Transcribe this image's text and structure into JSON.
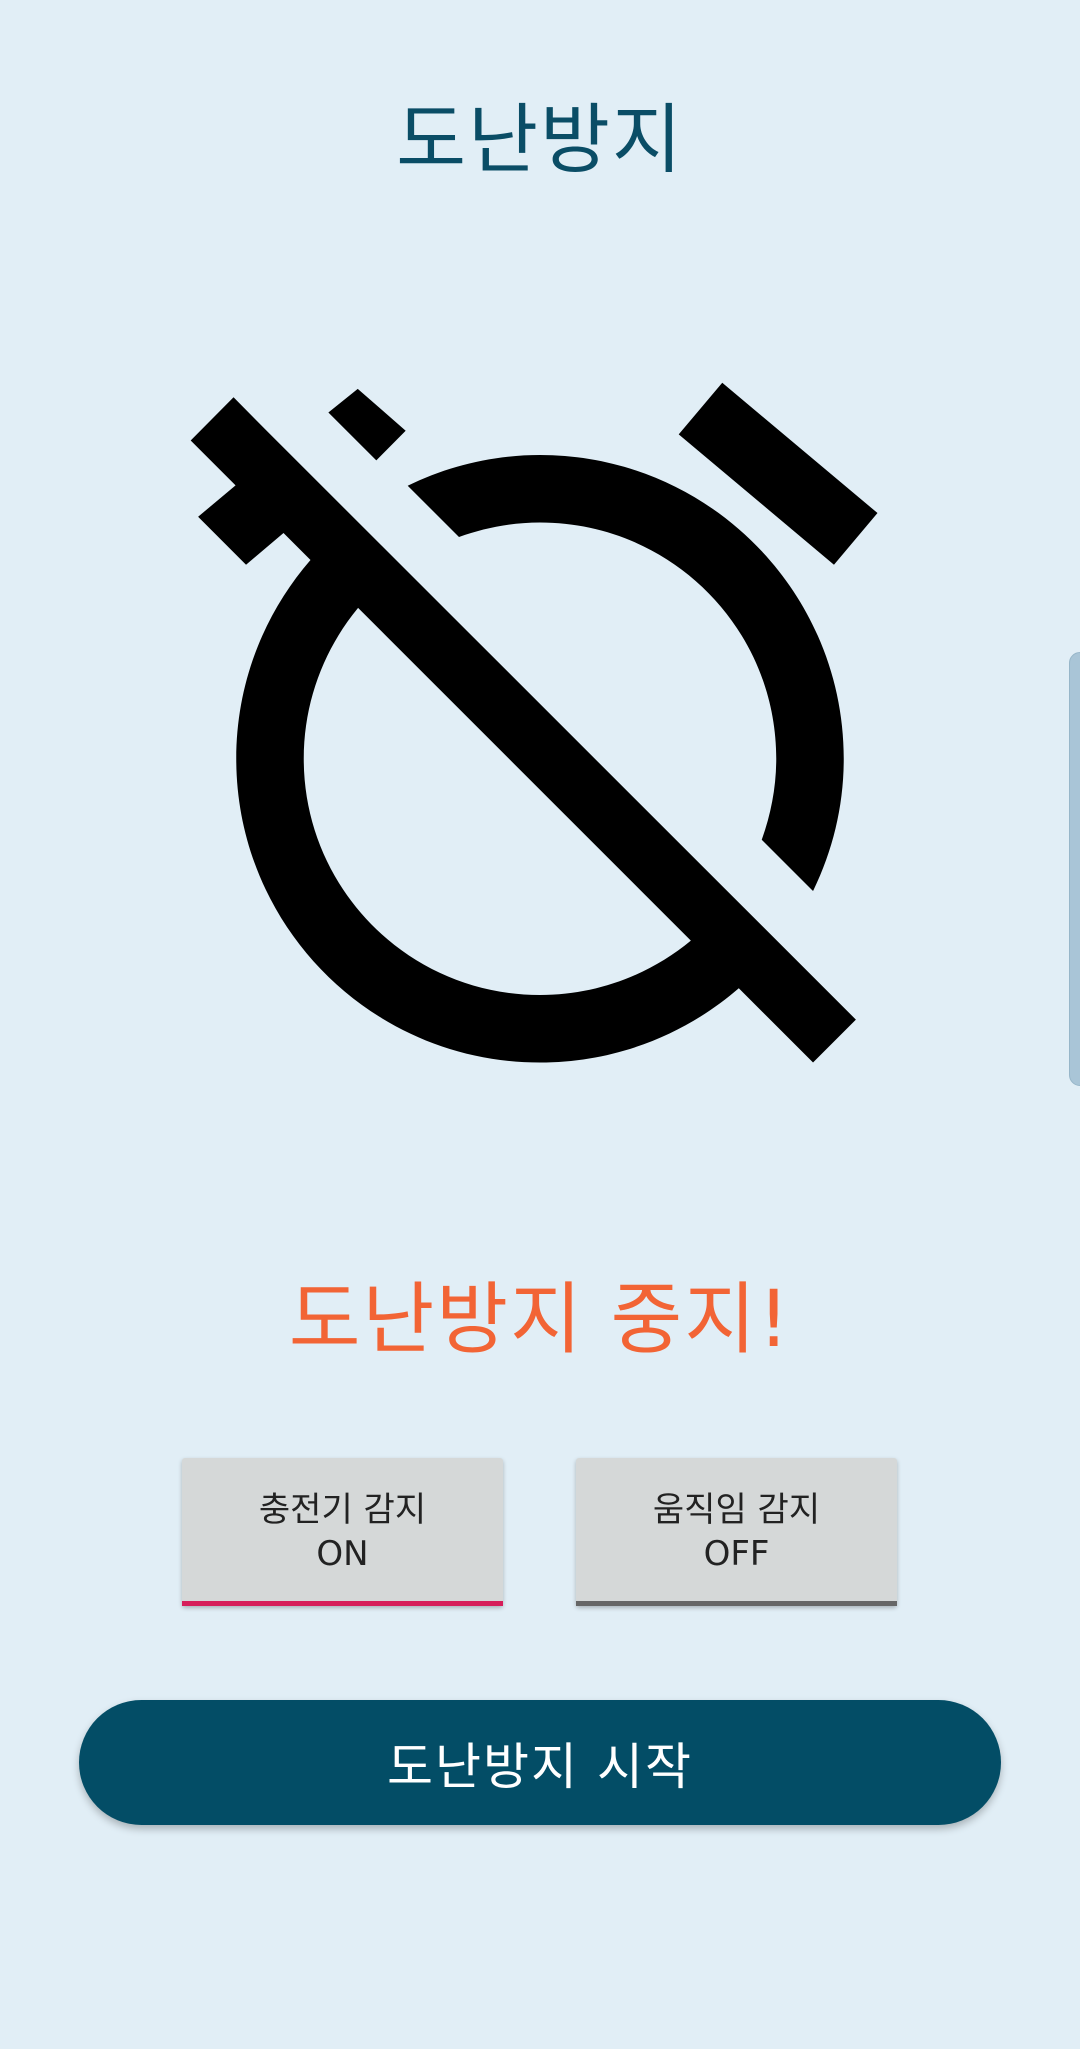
{
  "header": {
    "title": "도난방지"
  },
  "main": {
    "icon": "alarm-off-icon",
    "status": "도난방지 중지!",
    "status_color": "#f26435"
  },
  "toggles": [
    {
      "label": "충전기 감지",
      "state": "ON",
      "indicator_color": "#d61e5a"
    },
    {
      "label": "움직임 감지",
      "state": "OFF",
      "indicator_color": "#666666"
    }
  ],
  "actions": {
    "start_label": "도난방지 시작"
  },
  "colors": {
    "background": "#e1eef6",
    "primary": "#034d66",
    "title": "#0a4d66"
  }
}
